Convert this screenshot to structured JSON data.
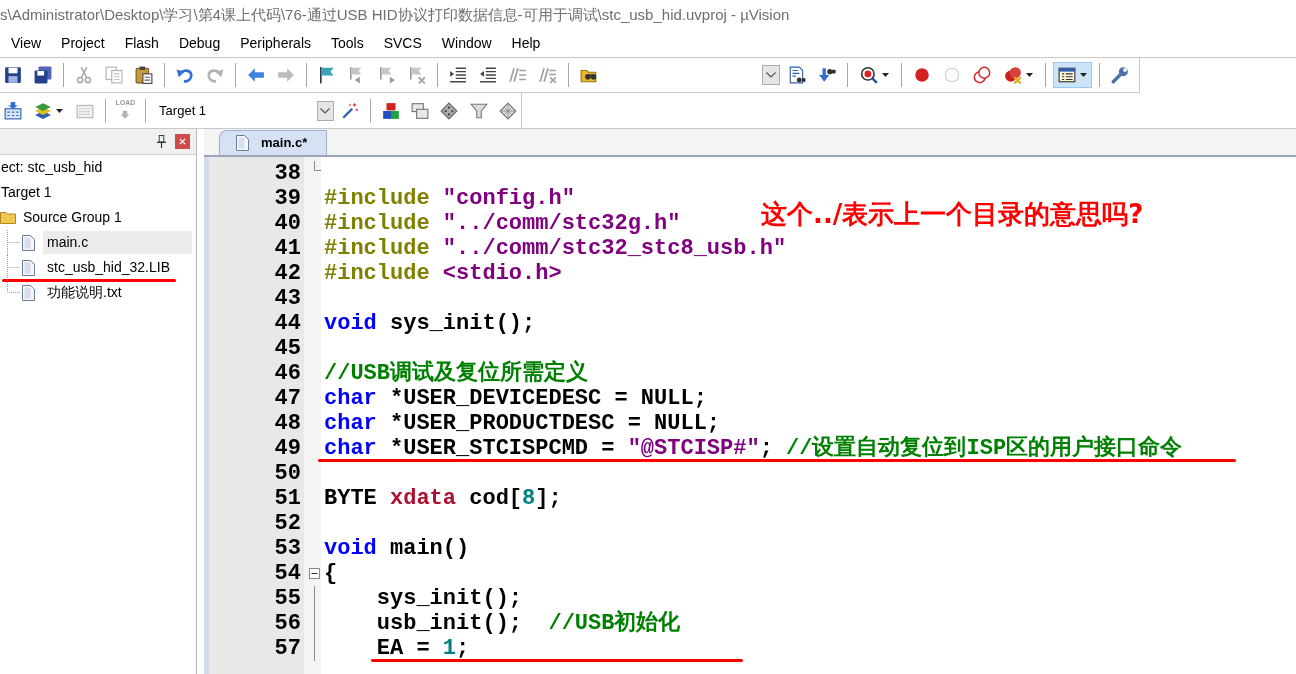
{
  "window": {
    "title": "s\\Administrator\\Desktop\\学习\\第4课上代码\\76-通过USB HID协议打印数据信息-可用于调试\\stc_usb_hid.uvproj - µVision"
  },
  "menu": [
    "View",
    "Project",
    "Flash",
    "Debug",
    "Peripherals",
    "Tools",
    "SVCS",
    "Window",
    "Help"
  ],
  "toolbars": [
    {
      "items": [
        {
          "kind": "save",
          "disabled": false,
          "on": false
        },
        {
          "kind": "save-all",
          "disabled": false,
          "on": false
        },
        {
          "kind": "separator"
        },
        {
          "kind": "cut",
          "disabled": true,
          "on": false
        },
        {
          "kind": "copy",
          "disabled": true,
          "on": false
        },
        {
          "kind": "paste",
          "disabled": false,
          "on": false
        },
        {
          "kind": "separator"
        },
        {
          "kind": "undo",
          "disabled": false,
          "on": false
        },
        {
          "kind": "redo",
          "disabled": true,
          "on": false
        },
        {
          "kind": "separator"
        },
        {
          "kind": "back",
          "disabled": false,
          "on": false
        },
        {
          "kind": "forward",
          "disabled": true,
          "on": false
        },
        {
          "kind": "separator"
        },
        {
          "kind": "bookmark",
          "disabled": false,
          "on": false
        },
        {
          "kind": "bookmark-prev",
          "disabled": true,
          "on": false
        },
        {
          "kind": "bookmark-next",
          "disabled": true,
          "on": false
        },
        {
          "kind": "bookmark-clear",
          "disabled": true,
          "on": false
        },
        {
          "kind": "separator"
        },
        {
          "kind": "indent",
          "disabled": false,
          "on": false
        },
        {
          "kind": "unindent",
          "disabled": false,
          "on": false
        },
        {
          "kind": "comment",
          "disabled": true,
          "on": false
        },
        {
          "kind": "uncomment",
          "disabled": true,
          "on": false
        },
        {
          "kind": "separator"
        },
        {
          "kind": "find-files",
          "disabled": false,
          "on": false
        },
        {
          "kind": "dropdown"
        },
        {
          "kind": "find",
          "disabled": false,
          "on": false
        },
        {
          "kind": "incremental-find",
          "disabled": false,
          "on": false
        },
        {
          "kind": "separator"
        },
        {
          "kind": "debug",
          "disabled": false,
          "on": false,
          "menu": true
        },
        {
          "kind": "separator"
        },
        {
          "kind": "breakpoint",
          "disabled": false,
          "on": false
        },
        {
          "kind": "breakpoint-enable",
          "disabled": true,
          "on": false
        },
        {
          "kind": "breakpoint-disable-all",
          "disabled": false,
          "on": false
        },
        {
          "kind": "breakpoint-kill",
          "disabled": false,
          "on": false,
          "menu": true
        },
        {
          "kind": "separator"
        },
        {
          "kind": "window-layout",
          "disabled": false,
          "on": true,
          "menu": true
        },
        {
          "kind": "separator"
        },
        {
          "kind": "configure",
          "disabled": false,
          "on": false
        }
      ]
    },
    {
      "items": [
        {
          "kind": "translate",
          "disabled": false,
          "on": false
        },
        {
          "kind": "build",
          "disabled": false,
          "on": false,
          "menu": true
        },
        {
          "kind": "rebuild",
          "disabled": true,
          "on": false
        },
        {
          "kind": "separator"
        },
        {
          "kind": "load",
          "label": "LOAD",
          "disabled": true,
          "on": false
        },
        {
          "kind": "separator"
        },
        {
          "kind": "select",
          "value": "Target 1"
        },
        {
          "kind": "options",
          "disabled": false,
          "on": false
        },
        {
          "kind": "separator"
        },
        {
          "kind": "components",
          "disabled": false,
          "on": false
        },
        {
          "kind": "stacked-windows",
          "disabled": false,
          "on": false
        },
        {
          "kind": "diamond",
          "disabled": false,
          "on": false
        },
        {
          "kind": "funnel",
          "disabled": false,
          "on": false
        },
        {
          "kind": "diamond-grid",
          "disabled": false,
          "on": false
        }
      ]
    }
  ],
  "project_panel": {
    "tree": [
      {
        "kind": "project",
        "label": "ect: stc_usb_hid",
        "selected": false,
        "children": [
          {
            "kind": "target",
            "label": "Target 1",
            "selected": false,
            "children": [
              {
                "kind": "group",
                "label": "Source Group 1",
                "selected": false,
                "children": [
                  {
                    "kind": "file",
                    "label": "main.c",
                    "selected": true
                  },
                  {
                    "kind": "file",
                    "label": "stc_usb_hid_32.LIB",
                    "selected": false,
                    "underlined": true
                  },
                  {
                    "kind": "file",
                    "label": "功能说明.txt",
                    "selected": false
                  }
                ]
              }
            ]
          }
        ]
      }
    ]
  },
  "editor": {
    "tabs": [
      {
        "label": "main.c*",
        "selected": true
      }
    ],
    "lines": [
      {
        "number": "38",
        "fold": {
          "kind": "end"
        }
      },
      {
        "number": "39",
        "tokens": [
          {
            "kind": "directive",
            "text": "#include "
          },
          {
            "kind": "string",
            "text": "\"config.h\""
          }
        ]
      },
      {
        "number": "40",
        "tokens": [
          {
            "kind": "directive",
            "text": "#include "
          },
          {
            "kind": "string",
            "text": "\"../comm/stc32g.h\""
          }
        ]
      },
      {
        "number": "41",
        "tokens": [
          {
            "kind": "directive",
            "text": "#include "
          },
          {
            "kind": "string",
            "text": "\"../comm/stc32_stc8_usb.h\""
          }
        ]
      },
      {
        "number": "42",
        "tokens": [
          {
            "kind": "directive",
            "text": "#include "
          },
          {
            "kind": "string",
            "text": "<stdio.h>"
          }
        ]
      },
      {
        "number": "43"
      },
      {
        "number": "44",
        "tokens": [
          {
            "kind": "keyword",
            "text": "void"
          },
          {
            "kind": "plain",
            "text": " sys_init();"
          }
        ]
      },
      {
        "number": "45"
      },
      {
        "number": "46",
        "tokens": [
          {
            "kind": "comment",
            "text": "//USB调试及复位所需定义"
          }
        ]
      },
      {
        "number": "47",
        "tokens": [
          {
            "kind": "keyword",
            "text": "char"
          },
          {
            "kind": "plain",
            "text": " *USER_DEVICEDESC = NULL;"
          }
        ]
      },
      {
        "number": "48",
        "tokens": [
          {
            "kind": "keyword",
            "text": "char"
          },
          {
            "kind": "plain",
            "text": " *USER_PRODUCTDESC = NULL;"
          }
        ]
      },
      {
        "number": "49",
        "underlined": true,
        "tokens": [
          {
            "kind": "keyword",
            "text": "char"
          },
          {
            "kind": "plain",
            "text": " *USER_STCISPCMD = "
          },
          {
            "kind": "string",
            "text": "\"@STCISP#\""
          },
          {
            "kind": "plain",
            "text": "; "
          },
          {
            "kind": "comment",
            "text": "//设置自动复位到ISP区的用户接口命令"
          }
        ]
      },
      {
        "number": "50"
      },
      {
        "number": "51",
        "tokens": [
          {
            "kind": "plain",
            "text": "BYTE "
          },
          {
            "kind": "storage",
            "text": "xdata"
          },
          {
            "kind": "plain",
            "text": " cod["
          },
          {
            "kind": "number",
            "text": "8"
          },
          {
            "kind": "plain",
            "text": "];"
          }
        ]
      },
      {
        "number": "52"
      },
      {
        "number": "53",
        "tokens": [
          {
            "kind": "keyword",
            "text": "void"
          },
          {
            "kind": "plain",
            "text": " main()"
          }
        ]
      },
      {
        "number": "54",
        "fold": {
          "kind": "open"
        },
        "tokens": [
          {
            "kind": "plain",
            "text": "{"
          }
        ]
      },
      {
        "number": "55",
        "fold": {
          "kind": "inside"
        },
        "tokens": [
          {
            "kind": "plain",
            "text": "    sys_init();"
          }
        ]
      },
      {
        "number": "56",
        "fold": {
          "kind": "inside"
        },
        "tokens": [
          {
            "kind": "plain",
            "text": "    usb_init();  "
          },
          {
            "kind": "comment",
            "text": "//USB初始化"
          }
        ]
      },
      {
        "number": "57",
        "fold": {
          "kind": "inside"
        },
        "underlined": true,
        "tokens": [
          {
            "kind": "plain",
            "text": "    EA = "
          },
          {
            "kind": "number",
            "text": "1"
          },
          {
            "kind": "plain",
            "text": ";"
          }
        ]
      }
    ]
  },
  "annotation": "这个../表示上一个目录的意思吗?"
}
